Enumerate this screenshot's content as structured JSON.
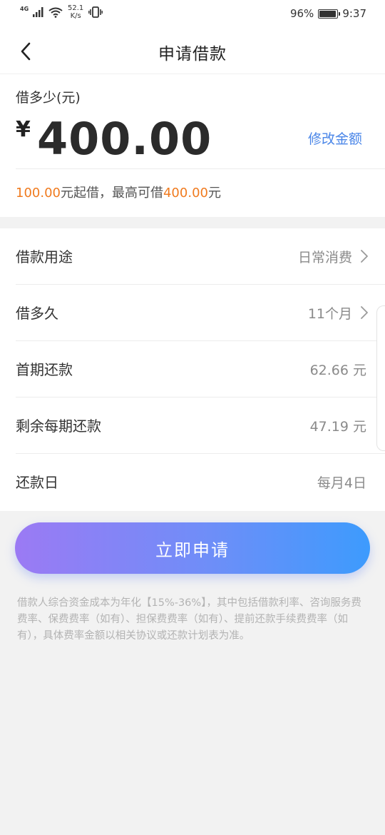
{
  "status_bar": {
    "network": "4G",
    "speed_value": "52.1",
    "speed_unit": "K/s",
    "battery_percent": "96%",
    "battery_level": 0.96,
    "time": "9:37"
  },
  "nav": {
    "title": "申请借款"
  },
  "amount": {
    "label": "借多少(元)",
    "currency": "¥",
    "value": "400.00",
    "modify_label": "修改金额",
    "min_amount": "100.00",
    "min_suffix": "元起借，最高可借",
    "max_amount": "400.00",
    "max_suffix": "元"
  },
  "details": {
    "rows": [
      {
        "label": "借款用途",
        "value": "日常消费"
      },
      {
        "label": "借多久",
        "value": "11个月"
      },
      {
        "label": "首期还款",
        "value": "62.66 元"
      },
      {
        "label": "剩余每期还款",
        "value": "47.19 元"
      },
      {
        "label": "还款日",
        "value": "每月4日"
      }
    ]
  },
  "apply_button": {
    "label": "立即申请"
  },
  "disclaimer": "借款人综合资金成本为年化【15%-36%】，其中包括借款利率、咨询服务费费率、保费费率（如有）、担保费费率（如有）、提前还款手续费费率（如有），具体费率金额以相关协议或还款计划表为准。",
  "colors": {
    "accent_orange": "#f07b1f",
    "link_blue": "#4a86e8",
    "button_gradient_start": "#9b7af4",
    "button_gradient_end": "#3d9bfd"
  }
}
